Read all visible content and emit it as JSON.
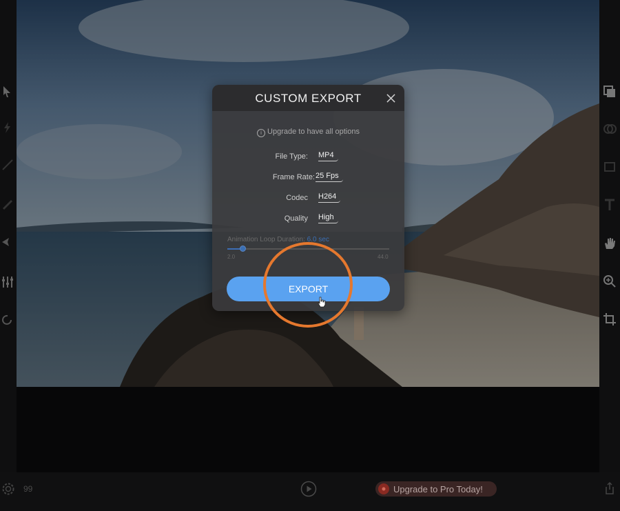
{
  "dialog": {
    "title": "CUSTOM  EXPORT",
    "notice": "Upgrade to have all options",
    "fields": [
      {
        "label": "File Type:",
        "value": "MP4"
      },
      {
        "label": "Frame Rate:",
        "value": "25 Fps"
      },
      {
        "label": "Codec",
        "value": "H264"
      },
      {
        "label": "Quality",
        "value": "High"
      }
    ],
    "loop_label": "Animation Loop Duration:",
    "loop_value": "6.0 sec",
    "slider": {
      "min_label": "2.0",
      "max_label": "44.0",
      "value": 6.0,
      "min": 2.0,
      "max": 44.0
    },
    "export_label": "EXPORT"
  },
  "bottom_bar": {
    "frame_count": "99",
    "upgrade_label": "Upgrade to Pro Today!"
  },
  "icons": {
    "left_toolbar": [
      "select-arrow-icon",
      "lightning-icon",
      "path-icon",
      "pen-icon",
      "anchor-icon",
      "sliders-icon",
      "rotate-icon"
    ],
    "right_toolbar": [
      "layers-icon",
      "overlay-icon",
      "mask-icon",
      "text-icon",
      "hand-icon",
      "zoom-icon",
      "crop-icon"
    ],
    "bottom": [
      "settings-gear-icon",
      "play-icon",
      "share-icon"
    ]
  },
  "colors": {
    "accent_blue": "#5aa2f0",
    "highlight_orange": "#e5782e",
    "slider_blue": "#3b6fb3"
  }
}
